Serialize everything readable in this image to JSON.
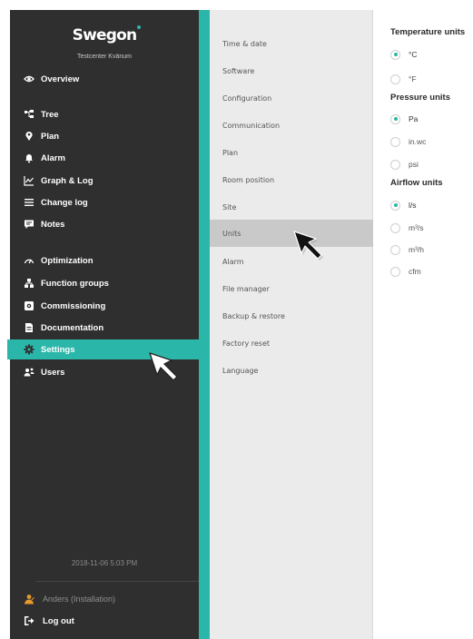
{
  "brand": {
    "name": "Swegon",
    "site": "Testcenter Kvänum"
  },
  "nav": [
    {
      "label": "Overview",
      "icon": "eye-icon"
    },
    {
      "label": "Tree",
      "icon": "tree-icon"
    },
    {
      "label": "Plan",
      "icon": "map-pin-icon"
    },
    {
      "label": "Alarm",
      "icon": "bell-icon"
    },
    {
      "label": "Graph & Log",
      "icon": "graph-icon"
    },
    {
      "label": "Change log",
      "icon": "list-icon"
    },
    {
      "label": "Notes",
      "icon": "notes-icon"
    },
    {
      "label": "Optimization",
      "icon": "gauge-icon"
    },
    {
      "label": "Function groups",
      "icon": "function-groups-icon"
    },
    {
      "label": "Commissioning",
      "icon": "commissioning-icon"
    },
    {
      "label": "Documentation",
      "icon": "document-icon"
    },
    {
      "label": "Settings",
      "icon": "gear-icon",
      "active": true
    },
    {
      "label": "Users",
      "icon": "users-icon"
    }
  ],
  "footer": {
    "datetime": "2018-11-06 5:03 PM",
    "user": "Anders (Installation)",
    "logout": "Log out"
  },
  "submenu": [
    {
      "label": "Time & date"
    },
    {
      "label": "Software"
    },
    {
      "label": "Configuration"
    },
    {
      "label": "Communication"
    },
    {
      "label": "Plan"
    },
    {
      "label": "Room position"
    },
    {
      "label": "Site"
    },
    {
      "label": "Units",
      "selected": true
    },
    {
      "label": "Alarm"
    },
    {
      "label": "File manager"
    },
    {
      "label": "Backup & restore"
    },
    {
      "label": "Factory reset"
    },
    {
      "label": "Language"
    }
  ],
  "units": {
    "temperature": {
      "title": "Temperature units",
      "options": [
        "°C",
        "°F"
      ],
      "selected": "°C"
    },
    "pressure": {
      "title": "Pressure units",
      "options": [
        "Pa",
        "in.wc",
        "psi"
      ],
      "selected": "Pa"
    },
    "airflow": {
      "title": "Airflow units",
      "options": [
        "l/s",
        "m³/s",
        "m³/h",
        "cfm"
      ],
      "selected": "l/s"
    }
  },
  "colors": {
    "accent": "#2ab7a9",
    "sidebar": "#2f2f2f",
    "submenu": "#ebebeb",
    "selected_row": "#c9c9c9",
    "user_icon": "#e89a2c"
  }
}
